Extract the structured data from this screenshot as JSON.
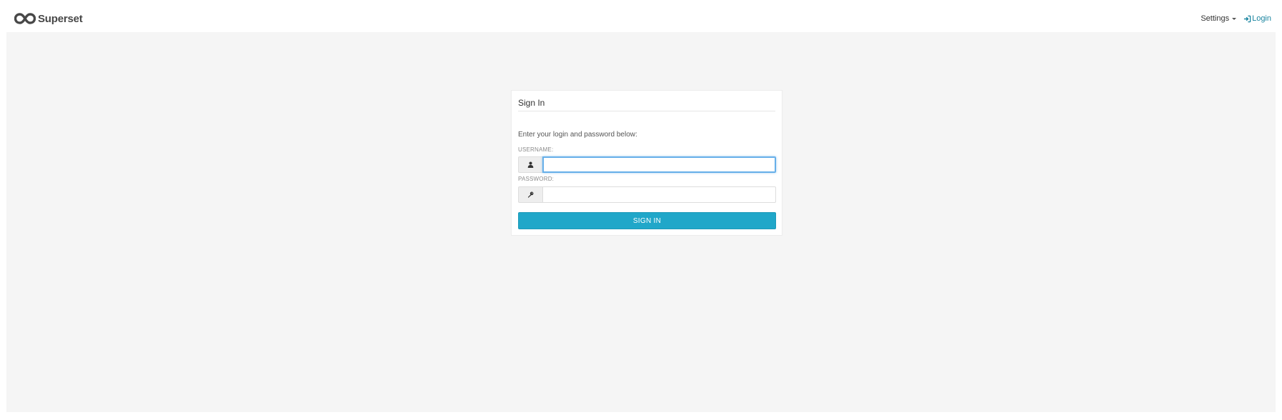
{
  "navbar": {
    "brand_name": "Superset",
    "settings_label": "Settings",
    "login_label": "Login",
    "link_color": "#1a85a0"
  },
  "login_panel": {
    "title": "Sign In",
    "description": "Enter your login and password below:",
    "username_label": "USERNAME:",
    "username_value": "",
    "username_icon": "user-icon",
    "password_label": "PASSWORD:",
    "password_value": "",
    "password_icon": "key-icon",
    "submit_label": "SIGN IN",
    "submit_color": "#20a7c9"
  }
}
